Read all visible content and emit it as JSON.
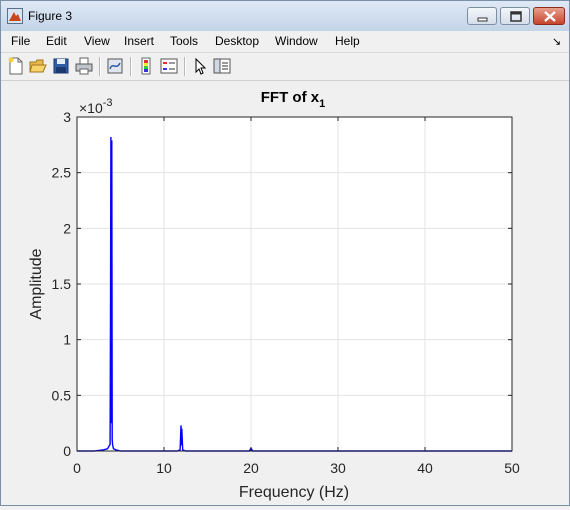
{
  "window": {
    "title": "Figure 3"
  },
  "menu": {
    "items": [
      "File",
      "Edit",
      "View",
      "Insert",
      "Tools",
      "Desktop",
      "Window",
      "Help"
    ],
    "overflow_icon": "dock-arrow-icon"
  },
  "toolbar": {
    "icons": [
      "new-figure-icon",
      "open-file-icon",
      "save-icon",
      "print-icon",
      "link-plot-icon",
      "colorbar-icon",
      "legend-icon",
      "select-arrow-icon",
      "property-inspector-icon"
    ]
  },
  "chart_data": {
    "type": "line",
    "title_main": "FFT of x",
    "title_sub": "1",
    "xlabel": "Frequency (Hz)",
    "ylabel": "Amplitude",
    "xlim": [
      0,
      50
    ],
    "ylim": [
      0,
      3
    ],
    "exponent_base": "×10",
    "exponent_power": "-3",
    "grid": true,
    "color": "#0000ff",
    "x_ticks": [
      "0",
      "10",
      "20",
      "30",
      "40",
      "50"
    ],
    "y_ticks": [
      "0",
      "0.5",
      "1",
      "1.5",
      "2",
      "2.5",
      "3"
    ],
    "peaks": [
      {
        "x": 3.9,
        "y": 2.82
      },
      {
        "x": 4.0,
        "y": 2.79
      },
      {
        "x": 12.0,
        "y": 0.23
      },
      {
        "x": 20.0,
        "y": 0.02
      }
    ],
    "series": [
      {
        "x": [
          0,
          2,
          3,
          3.5,
          3.8,
          3.85,
          3.9,
          3.95,
          4.0,
          4.05,
          4.1,
          4.2,
          4.5,
          5,
          7,
          11.5,
          11.85,
          11.95,
          12.0,
          12.05,
          12.15,
          12.5,
          19.8,
          19.95,
          20.0,
          20.05,
          20.2,
          50
        ],
        "y": [
          0.0,
          0.0,
          0.01,
          0.02,
          0.06,
          1.22,
          2.82,
          0.25,
          2.79,
          0.1,
          0.05,
          0.02,
          0.01,
          0.0,
          0.0,
          0.0,
          0.01,
          0.23,
          0.05,
          0.2,
          0.01,
          0.0,
          0.0,
          0.02,
          0.0,
          0.02,
          0.0,
          0.0
        ]
      }
    ]
  }
}
